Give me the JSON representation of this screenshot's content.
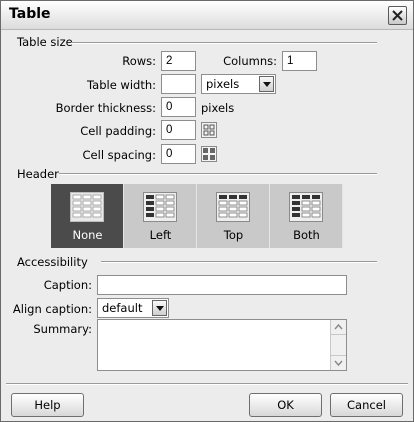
{
  "window": {
    "title": "Table"
  },
  "table_size": {
    "legend": "Table size",
    "rows_label": "Rows:",
    "rows_value": "2",
    "columns_label": "Columns:",
    "columns_value": "1",
    "width_label": "Table width:",
    "width_value": "",
    "width_unit": "pixels",
    "border_label": "Border thickness:",
    "border_value": "0",
    "border_unit": "pixels",
    "padding_label": "Cell padding:",
    "padding_value": "0",
    "spacing_label": "Cell spacing:",
    "spacing_value": "0"
  },
  "header": {
    "legend": "Header",
    "options": [
      {
        "label": "None",
        "selected": true
      },
      {
        "label": "Left",
        "selected": false
      },
      {
        "label": "Top",
        "selected": false
      },
      {
        "label": "Both",
        "selected": false
      }
    ]
  },
  "accessibility": {
    "legend": "Accessibility",
    "caption_label": "Caption:",
    "caption_value": "",
    "align_label": "Align caption:",
    "align_value": "default",
    "summary_label": "Summary:",
    "summary_value": ""
  },
  "buttons": {
    "help": "Help",
    "ok": "OK",
    "cancel": "Cancel"
  },
  "icons": {
    "close": "close-icon",
    "dropdown": "chevron-down-icon",
    "cell_padding": "cell-padding-icon",
    "cell_spacing": "cell-spacing-icon",
    "header_none": "table-header-none-icon",
    "header_left": "table-header-left-icon",
    "header_top": "table-header-top-icon",
    "header_both": "table-header-both-icon"
  },
  "colors": {
    "selected_header": "#4b4b4b",
    "dialog_bg": "#ececec"
  }
}
